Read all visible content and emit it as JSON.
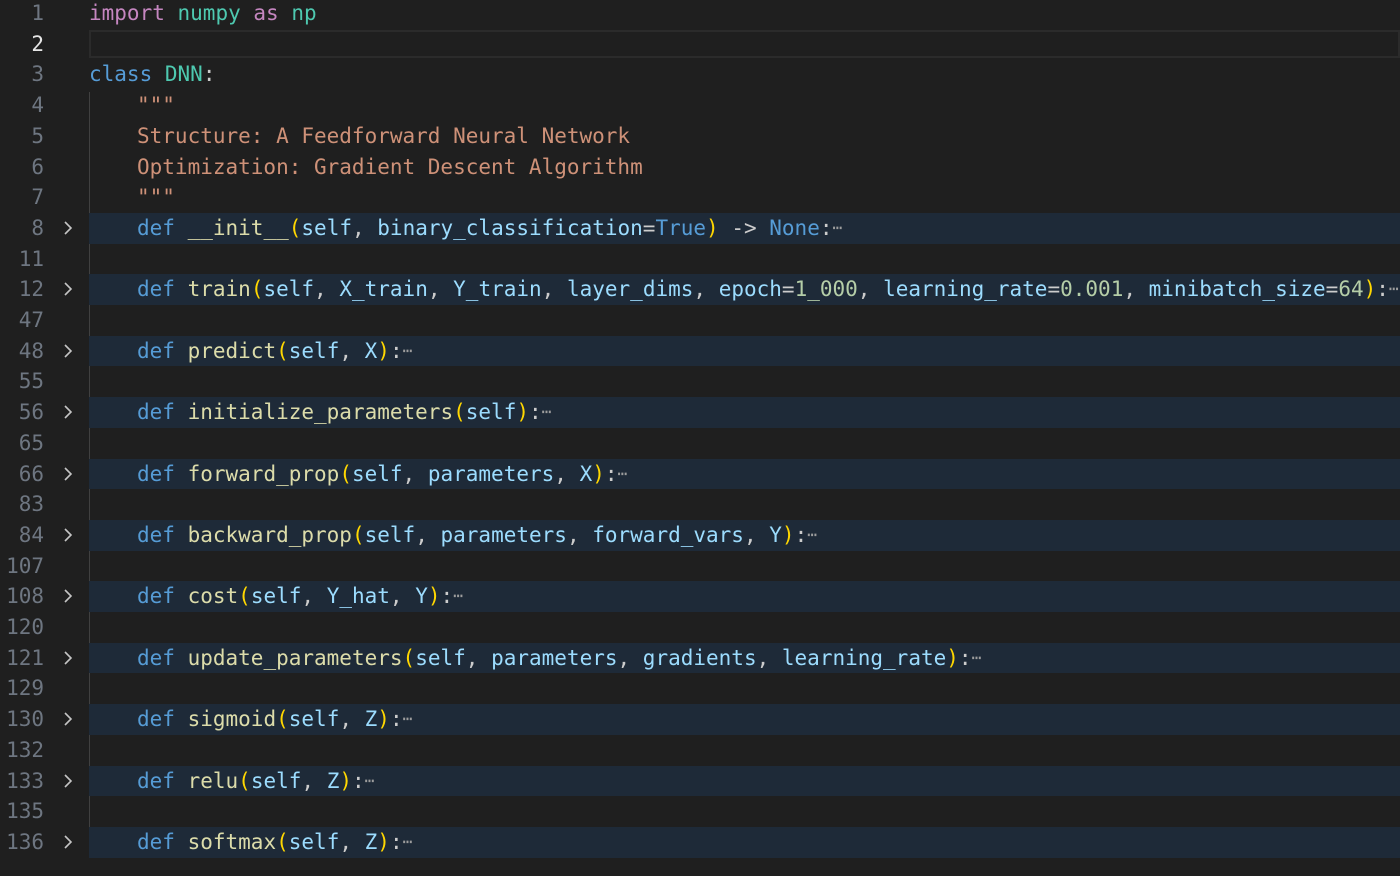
{
  "editor": {
    "line_numbers": [
      "1",
      "2",
      "3",
      "4",
      "5",
      "6",
      "7",
      "8",
      "11",
      "12",
      "47",
      "48",
      "55",
      "56",
      "65",
      "66",
      "83",
      "84",
      "107",
      "108",
      "120",
      "121",
      "129",
      "130",
      "132",
      "133",
      "135",
      "136"
    ],
    "active_line": "2",
    "header": {
      "import_kw": "import",
      "module": "numpy",
      "as_kw": "as",
      "alias": "np",
      "class_kw": "class",
      "class_name": "DNN",
      "colon": ":"
    },
    "docstring": {
      "open_quotes": "\"\"\"",
      "line1": "Structure: A Feedforward Neural Network",
      "line2": "Optimization: Gradient Descent Algorithm",
      "close_quotes": "\"\"\""
    },
    "def_kw": "def",
    "methods": [
      {
        "name": "__init__",
        "params": [
          "self",
          "binary_classification=True"
        ],
        "returns": "None"
      },
      {
        "name": "train",
        "params": [
          "self",
          "X_train",
          "Y_train",
          "layer_dims",
          "epoch=1_000",
          "learning_rate=0.001",
          "minibatch_size=64"
        ]
      },
      {
        "name": "predict",
        "params": [
          "self",
          "X"
        ]
      },
      {
        "name": "initialize_parameters",
        "params": [
          "self"
        ]
      },
      {
        "name": "forward_prop",
        "params": [
          "self",
          "parameters",
          "X"
        ]
      },
      {
        "name": "backward_prop",
        "params": [
          "self",
          "parameters",
          "forward_vars",
          "Y"
        ]
      },
      {
        "name": "cost",
        "params": [
          "self",
          "Y_hat",
          "Y"
        ]
      },
      {
        "name": "update_parameters",
        "params": [
          "self",
          "parameters",
          "gradients",
          "learning_rate"
        ]
      },
      {
        "name": "sigmoid",
        "params": [
          "self",
          "Z"
        ]
      },
      {
        "name": "relu",
        "params": [
          "self",
          "Z"
        ]
      },
      {
        "name": "softmax",
        "params": [
          "self",
          "Z"
        ]
      }
    ],
    "arrow": "->",
    "ellipsis": "⋯",
    "colors": {
      "background": "#1f1f1f",
      "folded_highlight": "#1e2a38",
      "keyword": "#569cd6",
      "import_keyword": "#c586c0",
      "class_name": "#4ec9b0",
      "function": "#dcdcaa",
      "parameter": "#9cdcfe",
      "string": "#ce9178",
      "number": "#b5cea8",
      "bracket": "#ffd700"
    }
  }
}
